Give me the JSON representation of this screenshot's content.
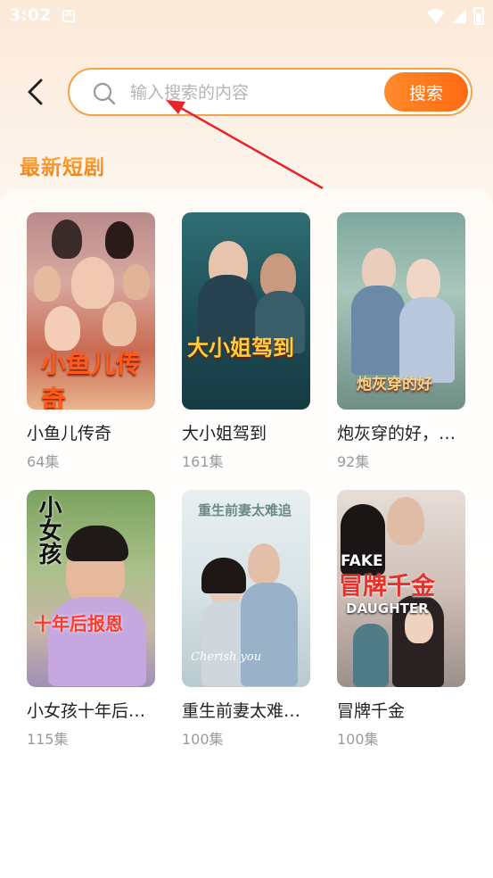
{
  "status_bar": {
    "time": "3:02"
  },
  "search": {
    "placeholder": "输入搜索的内容",
    "value": "",
    "button_label": "搜索"
  },
  "section": {
    "title": "最新短剧"
  },
  "dramas": [
    {
      "title": "小鱼儿传奇",
      "episodes": "64集",
      "poster_text": "小鱼儿传奇"
    },
    {
      "title": "大小姐驾到",
      "episodes": "161集",
      "poster_text": "大小姐驾到"
    },
    {
      "title": "炮灰穿的好，…",
      "episodes": "92集",
      "poster_text": "炮灰穿的好"
    },
    {
      "title": "小女孩十年后…",
      "episodes": "115集",
      "poster_text_top": "小女孩",
      "poster_text_bottom": "十年后报恩"
    },
    {
      "title": "重生前妻太难…",
      "episodes": "100集",
      "poster_text": "重生前妻太难追",
      "poster_subtext": "Cherish you"
    },
    {
      "title": "冒牌千金",
      "episodes": "100集",
      "poster_text_en_top": "FAKE",
      "poster_text": "冒牌千金",
      "poster_text_en_bottom": "DAUGHTER"
    }
  ],
  "colors": {
    "accent": "#ff7a1a",
    "search_border": "#f6a24a",
    "annotation": "#e8232a"
  }
}
